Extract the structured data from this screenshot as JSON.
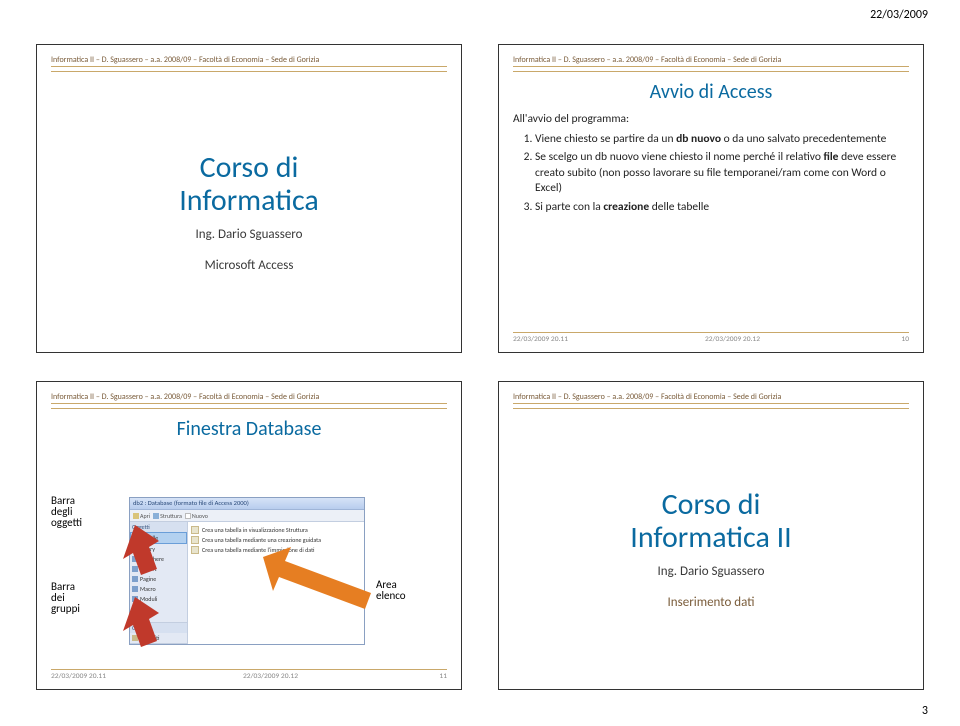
{
  "page": {
    "date": "22/03/2009",
    "number": "3"
  },
  "header_text": "Informatica II – D. Sguassero – a.a. 2008/09 – Facoltà di Economia – Sede di Gorizia",
  "footer": {
    "t1": "22/03/2009 20.11",
    "t2": "22/03/2009 20.12"
  },
  "slide1": {
    "title": "Corso di\nInformatica",
    "author": "Ing. Dario Sguassero",
    "subject": "Microsoft Access"
  },
  "slide2": {
    "title": "Avvio di Access",
    "intro": "All'avvio del programma:",
    "items": [
      "Viene chiesto se partire da un db nuovo o da uno salvato precedentemente",
      "Se scelgo un db nuovo viene chiesto il nome perché il relativo file deve essere creato subito (non posso lavorare su file temporanei/ram come con Word o Excel)",
      "Si parte con la creazione delle tabelle"
    ],
    "slide_no": "10"
  },
  "slide3": {
    "title": "Finestra Database",
    "callouts": {
      "barra_oggetti": "Barra\ndegli\noggetti",
      "barra_gruppi": "Barra\ndei\ngruppi",
      "area_elenco": "Area\nelenco"
    },
    "db": {
      "titlebar": "db2 : Database (formato file di Access 2000)",
      "toolbar": {
        "apri": "Apri",
        "struttura": "Struttura",
        "nuovo": "Nuovo"
      },
      "side_groups": {
        "oggetti": "Oggetti",
        "items": [
          "Tabelle",
          "Query",
          "Maschere",
          "Report",
          "Pagine",
          "Macro",
          "Moduli"
        ],
        "gruppi": "Gruppi",
        "preferiti": "Preferiti"
      },
      "body": [
        "Crea una tabella in visualizzazione Struttura",
        "Crea una tabella mediante una creazione guidata",
        "Crea una tabella mediante l'immissione di dati"
      ]
    },
    "slide_no": "11"
  },
  "slide4": {
    "title": "Corso di\nInformatica II",
    "author": "Ing. Dario Sguassero",
    "subject": "Inserimento dati"
  }
}
